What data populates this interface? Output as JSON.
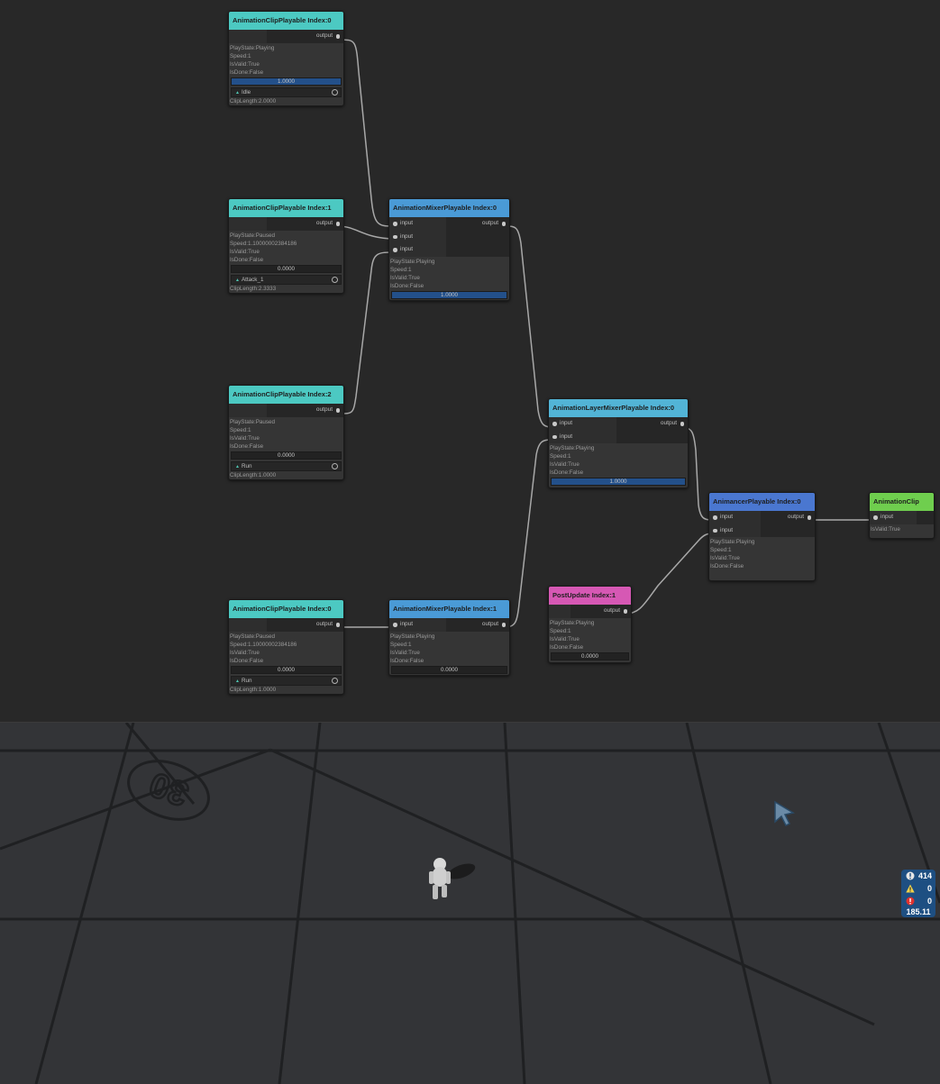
{
  "graph": {
    "nodes": {
      "clip0": {
        "title": "AnimationClipPlayable Index:0",
        "output": "output",
        "play_state": "PlayState:Playing",
        "speed": "Speed:1",
        "is_valid": "IsValid:True",
        "is_done": "IsDone:False",
        "weight": "1.0000",
        "weight_fill": 1.0,
        "clip": "Idle",
        "clip_length": "ClipLength:2.0000"
      },
      "clip1": {
        "title": "AnimationClipPlayable Index:1",
        "output": "output",
        "play_state": "PlayState:Paused",
        "speed": "Speed:1.10000002384186",
        "is_valid": "IsValid:True",
        "is_done": "IsDone:False",
        "weight": "0.0000",
        "weight_fill": 0.0,
        "clip": "Attack_1",
        "clip_length": "ClipLength:2.3333"
      },
      "clip2": {
        "title": "AnimationClipPlayable Index:2",
        "output": "output",
        "play_state": "PlayState:Paused",
        "speed": "Speed:1",
        "is_valid": "IsValid:True",
        "is_done": "IsDone:False",
        "weight": "0.0000",
        "weight_fill": 0.0,
        "clip": "Run",
        "clip_length": "ClipLength:1.0000"
      },
      "clip3": {
        "title": "AnimationClipPlayable Index:0",
        "output": "output",
        "play_state": "PlayState:Paused",
        "speed": "Speed:1.10000002384186",
        "is_valid": "IsValid:True",
        "is_done": "IsDone:False",
        "weight": "0.0000",
        "weight_fill": 0.0,
        "clip": "Run",
        "clip_length": "ClipLength:1.0000"
      },
      "mixer0": {
        "title": "AnimationMixerPlayable Index:0",
        "inputs": [
          "input",
          "input",
          "input"
        ],
        "output": "output",
        "play_state": "PlayState:Playing",
        "speed": "Speed:1",
        "is_valid": "IsValid:True",
        "is_done": "IsDone:False",
        "weight": "1.0000",
        "weight_fill": 1.0
      },
      "mixer1": {
        "title": "AnimationMixerPlayable Index:1",
        "inputs": [
          "input"
        ],
        "output": "output",
        "play_state": "PlayState:Playing",
        "speed": "Speed:1",
        "is_valid": "IsValid:True",
        "is_done": "IsDone:False",
        "weight": "0.0000",
        "weight_fill": 0.0
      },
      "layer": {
        "title": "AnimationLayerMixerPlayable Index:0",
        "inputs": [
          "input",
          "input"
        ],
        "output": "output",
        "play_state": "PlayState:Playing",
        "speed": "Speed:1",
        "is_valid": "IsValid:True",
        "is_done": "IsDone:False",
        "weight": "1.0000",
        "weight_fill": 1.0
      },
      "post": {
        "title": "PostUpdate Index:1",
        "output": "output",
        "play_state": "PlayState:Playing",
        "speed": "Speed:1",
        "is_valid": "IsValid:True",
        "is_done": "IsDone:False",
        "weight": "0.0000",
        "weight_fill": 0.0
      },
      "animancer": {
        "title": "AnimancerPlayable Index:0",
        "inputs": [
          "input",
          "input"
        ],
        "output": "output",
        "play_state": "PlayState:Playing",
        "speed": "Speed:1",
        "is_valid": "IsValid:True",
        "is_done": "IsDone:False"
      },
      "output": {
        "title": "AnimationClip",
        "inputs": [
          "input"
        ],
        "is_valid": "IsValid:True"
      }
    },
    "colors": {
      "clip_header": "#4cc9c2",
      "mixer_header": "#4a9ad6",
      "layer_header": "#52b4d6",
      "post_header": "#d658b4",
      "animancer_header": "#4a77d0",
      "output_header": "#6fce4e",
      "weight_bar": "#23508a",
      "wire": "#a8a8a8"
    }
  },
  "scene": {
    "floor_marking": "30"
  },
  "stats": {
    "log_count": "414",
    "warning_count": "0",
    "error_count": "0",
    "fps": "185.11",
    "colors": {
      "background": "#1e4f82"
    }
  },
  "icons": {
    "clip_triangle": "triangle-icon",
    "target": "object-picker-icon",
    "log": "info-icon",
    "warning": "warning-icon",
    "error": "error-icon",
    "cursor": "cursor-icon"
  }
}
